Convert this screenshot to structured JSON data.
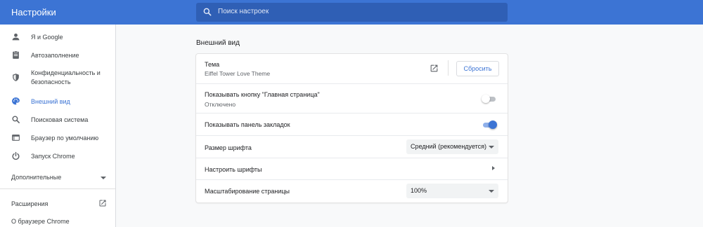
{
  "header": {
    "title": "Настройки",
    "search_placeholder": "Поиск настроек"
  },
  "sidebar": {
    "items": [
      {
        "label": "Я и Google",
        "icon": "person-icon"
      },
      {
        "label": "Автозаполнение",
        "icon": "clipboard-icon"
      },
      {
        "label": "Конфиденциальность и безопасность",
        "icon": "shield-icon"
      },
      {
        "label": "Внешний вид",
        "icon": "palette-icon",
        "active": true
      },
      {
        "label": "Поисковая система",
        "icon": "search-icon"
      },
      {
        "label": "Браузер по умолчанию",
        "icon": "browser-icon"
      },
      {
        "label": "Запуск Chrome",
        "icon": "power-icon"
      }
    ],
    "advanced_label": "Дополнительные",
    "extensions_label": "Расширения",
    "about_label": "О браузере Chrome"
  },
  "main": {
    "section_title": "Внешний вид",
    "theme": {
      "label": "Тема",
      "value": "Eiffel Tower Love Theme",
      "reset_label": "Сбросить"
    },
    "home_button": {
      "label": "Показывать кнопку \"Главная страница\"",
      "status": "Отключено",
      "enabled": false
    },
    "bookmarks_bar": {
      "label": "Показывать панель закладок",
      "enabled": true
    },
    "font_size": {
      "label": "Размер шрифта",
      "value": "Средний (рекомендуется)"
    },
    "customize_fonts": {
      "label": "Настроить шрифты"
    },
    "page_zoom": {
      "label": "Масштабирование страницы",
      "value": "100%"
    }
  },
  "colors": {
    "accent": "#3c74d4",
    "header_bg": "#3c74d4",
    "search_bg": "#2f5fb5"
  }
}
